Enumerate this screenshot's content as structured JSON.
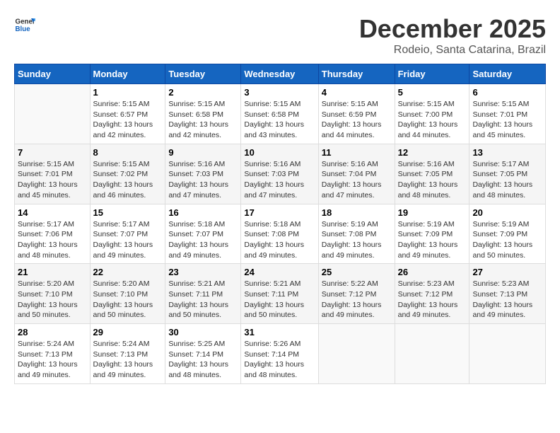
{
  "header": {
    "logo_general": "General",
    "logo_blue": "Blue",
    "title": "December 2025",
    "subtitle": "Rodeio, Santa Catarina, Brazil"
  },
  "days_of_week": [
    "Sunday",
    "Monday",
    "Tuesday",
    "Wednesday",
    "Thursday",
    "Friday",
    "Saturday"
  ],
  "weeks": [
    [
      {
        "day": "",
        "sunrise": "",
        "sunset": "",
        "daylight": ""
      },
      {
        "day": "1",
        "sunrise": "Sunrise: 5:15 AM",
        "sunset": "Sunset: 6:57 PM",
        "daylight": "Daylight: 13 hours and 42 minutes."
      },
      {
        "day": "2",
        "sunrise": "Sunrise: 5:15 AM",
        "sunset": "Sunset: 6:58 PM",
        "daylight": "Daylight: 13 hours and 42 minutes."
      },
      {
        "day": "3",
        "sunrise": "Sunrise: 5:15 AM",
        "sunset": "Sunset: 6:58 PM",
        "daylight": "Daylight: 13 hours and 43 minutes."
      },
      {
        "day": "4",
        "sunrise": "Sunrise: 5:15 AM",
        "sunset": "Sunset: 6:59 PM",
        "daylight": "Daylight: 13 hours and 44 minutes."
      },
      {
        "day": "5",
        "sunrise": "Sunrise: 5:15 AM",
        "sunset": "Sunset: 7:00 PM",
        "daylight": "Daylight: 13 hours and 44 minutes."
      },
      {
        "day": "6",
        "sunrise": "Sunrise: 5:15 AM",
        "sunset": "Sunset: 7:01 PM",
        "daylight": "Daylight: 13 hours and 45 minutes."
      }
    ],
    [
      {
        "day": "7",
        "sunrise": "Sunrise: 5:15 AM",
        "sunset": "Sunset: 7:01 PM",
        "daylight": "Daylight: 13 hours and 45 minutes."
      },
      {
        "day": "8",
        "sunrise": "Sunrise: 5:15 AM",
        "sunset": "Sunset: 7:02 PM",
        "daylight": "Daylight: 13 hours and 46 minutes."
      },
      {
        "day": "9",
        "sunrise": "Sunrise: 5:16 AM",
        "sunset": "Sunset: 7:03 PM",
        "daylight": "Daylight: 13 hours and 47 minutes."
      },
      {
        "day": "10",
        "sunrise": "Sunrise: 5:16 AM",
        "sunset": "Sunset: 7:03 PM",
        "daylight": "Daylight: 13 hours and 47 minutes."
      },
      {
        "day": "11",
        "sunrise": "Sunrise: 5:16 AM",
        "sunset": "Sunset: 7:04 PM",
        "daylight": "Daylight: 13 hours and 47 minutes."
      },
      {
        "day": "12",
        "sunrise": "Sunrise: 5:16 AM",
        "sunset": "Sunset: 7:05 PM",
        "daylight": "Daylight: 13 hours and 48 minutes."
      },
      {
        "day": "13",
        "sunrise": "Sunrise: 5:17 AM",
        "sunset": "Sunset: 7:05 PM",
        "daylight": "Daylight: 13 hours and 48 minutes."
      }
    ],
    [
      {
        "day": "14",
        "sunrise": "Sunrise: 5:17 AM",
        "sunset": "Sunset: 7:06 PM",
        "daylight": "Daylight: 13 hours and 48 minutes."
      },
      {
        "day": "15",
        "sunrise": "Sunrise: 5:17 AM",
        "sunset": "Sunset: 7:07 PM",
        "daylight": "Daylight: 13 hours and 49 minutes."
      },
      {
        "day": "16",
        "sunrise": "Sunrise: 5:18 AM",
        "sunset": "Sunset: 7:07 PM",
        "daylight": "Daylight: 13 hours and 49 minutes."
      },
      {
        "day": "17",
        "sunrise": "Sunrise: 5:18 AM",
        "sunset": "Sunset: 7:08 PM",
        "daylight": "Daylight: 13 hours and 49 minutes."
      },
      {
        "day": "18",
        "sunrise": "Sunrise: 5:19 AM",
        "sunset": "Sunset: 7:08 PM",
        "daylight": "Daylight: 13 hours and 49 minutes."
      },
      {
        "day": "19",
        "sunrise": "Sunrise: 5:19 AM",
        "sunset": "Sunset: 7:09 PM",
        "daylight": "Daylight: 13 hours and 49 minutes."
      },
      {
        "day": "20",
        "sunrise": "Sunrise: 5:19 AM",
        "sunset": "Sunset: 7:09 PM",
        "daylight": "Daylight: 13 hours and 50 minutes."
      }
    ],
    [
      {
        "day": "21",
        "sunrise": "Sunrise: 5:20 AM",
        "sunset": "Sunset: 7:10 PM",
        "daylight": "Daylight: 13 hours and 50 minutes."
      },
      {
        "day": "22",
        "sunrise": "Sunrise: 5:20 AM",
        "sunset": "Sunset: 7:10 PM",
        "daylight": "Daylight: 13 hours and 50 minutes."
      },
      {
        "day": "23",
        "sunrise": "Sunrise: 5:21 AM",
        "sunset": "Sunset: 7:11 PM",
        "daylight": "Daylight: 13 hours and 50 minutes."
      },
      {
        "day": "24",
        "sunrise": "Sunrise: 5:21 AM",
        "sunset": "Sunset: 7:11 PM",
        "daylight": "Daylight: 13 hours and 50 minutes."
      },
      {
        "day": "25",
        "sunrise": "Sunrise: 5:22 AM",
        "sunset": "Sunset: 7:12 PM",
        "daylight": "Daylight: 13 hours and 49 minutes."
      },
      {
        "day": "26",
        "sunrise": "Sunrise: 5:23 AM",
        "sunset": "Sunset: 7:12 PM",
        "daylight": "Daylight: 13 hours and 49 minutes."
      },
      {
        "day": "27",
        "sunrise": "Sunrise: 5:23 AM",
        "sunset": "Sunset: 7:13 PM",
        "daylight": "Daylight: 13 hours and 49 minutes."
      }
    ],
    [
      {
        "day": "28",
        "sunrise": "Sunrise: 5:24 AM",
        "sunset": "Sunset: 7:13 PM",
        "daylight": "Daylight: 13 hours and 49 minutes."
      },
      {
        "day": "29",
        "sunrise": "Sunrise: 5:24 AM",
        "sunset": "Sunset: 7:13 PM",
        "daylight": "Daylight: 13 hours and 49 minutes."
      },
      {
        "day": "30",
        "sunrise": "Sunrise: 5:25 AM",
        "sunset": "Sunset: 7:14 PM",
        "daylight": "Daylight: 13 hours and 48 minutes."
      },
      {
        "day": "31",
        "sunrise": "Sunrise: 5:26 AM",
        "sunset": "Sunset: 7:14 PM",
        "daylight": "Daylight: 13 hours and 48 minutes."
      },
      {
        "day": "",
        "sunrise": "",
        "sunset": "",
        "daylight": ""
      },
      {
        "day": "",
        "sunrise": "",
        "sunset": "",
        "daylight": ""
      },
      {
        "day": "",
        "sunrise": "",
        "sunset": "",
        "daylight": ""
      }
    ]
  ]
}
